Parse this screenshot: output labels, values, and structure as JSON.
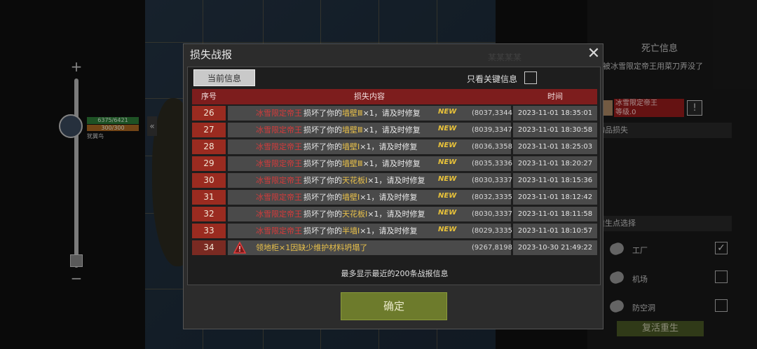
{
  "left_hud": {
    "zoom_in": "+",
    "zoom_out": "−",
    "hp": "6375/6421",
    "energy": "300/300",
    "player_name": "犹翼鸟",
    "collapse_glyph": "«"
  },
  "right_panel": {
    "title": "死亡信息",
    "description": "被冰雪限定帝王用菜刀弄没了",
    "killer_name": "冰雪限定帝王",
    "killer_level": "等级.0",
    "warn_glyph": "!",
    "section_loss": "物品损失",
    "section_respawn": "重生点选择",
    "options": [
      {
        "label": "工厂",
        "checked": "✓"
      },
      {
        "label": "机场",
        "checked": ""
      },
      {
        "label": "防空洞",
        "checked": ""
      }
    ],
    "revive_label": "复活重生"
  },
  "modal": {
    "title": "损失战报",
    "watermark": "某某某某",
    "close_glyph": "✕",
    "tab_current": "当前信息",
    "key_only_label": "只看关键信息",
    "columns": {
      "num": "序号",
      "content": "损失内容",
      "time": "时间"
    },
    "new_tag": "NEW",
    "rows": [
      {
        "num": "26",
        "attacker": "冰雪限定帝王",
        "msg_pre": "损坏了你的",
        "item": "墙壁Ⅲ",
        "msg_post": "×1，请及时修复",
        "coord": "(8037,3344)",
        "time": "2023-11-01 18:35:01"
      },
      {
        "num": "27",
        "attacker": "冰雪限定帝王",
        "msg_pre": "损坏了你的",
        "item": "墙壁Ⅲ",
        "msg_post": "×1，请及时修复",
        "coord": "(8039,3347)",
        "time": "2023-11-01 18:30:58"
      },
      {
        "num": "28",
        "attacker": "冰雪限定帝王",
        "msg_pre": "损坏了你的",
        "item": "墙壁Ⅰ",
        "msg_post": "×1，请及时修复",
        "coord": "(8036,3358)",
        "time": "2023-11-01 18:25:03"
      },
      {
        "num": "29",
        "attacker": "冰雪限定帝王",
        "msg_pre": "损坏了你的",
        "item": "墙壁Ⅲ",
        "msg_post": "×1，请及时修复",
        "coord": "(8035,3336)",
        "time": "2023-11-01 18:20:27"
      },
      {
        "num": "30",
        "attacker": "冰雪限定帝王",
        "msg_pre": "损坏了你的",
        "item": "天花板Ⅰ",
        "msg_post": "×1，请及时修复",
        "coord": "(8030,3337)",
        "time": "2023-11-01 18:15:36"
      },
      {
        "num": "31",
        "attacker": "冰雪限定帝王",
        "msg_pre": "损坏了你的",
        "item": "墙壁Ⅰ",
        "msg_post": "×1，请及时修复",
        "coord": "(8032,3335)",
        "time": "2023-11-01 18:12:42"
      },
      {
        "num": "32",
        "attacker": "冰雪限定帝王",
        "msg_pre": "损坏了你的",
        "item": "天花板Ⅰ",
        "msg_post": "×1，请及时修复",
        "coord": "(8030,3337)",
        "time": "2023-11-01 18:11:58"
      },
      {
        "num": "33",
        "attacker": "冰雪限定帝王",
        "msg_pre": "损坏了你的",
        "item": "半墙Ⅰ",
        "msg_post": "×1，请及时修复",
        "coord": "(8029,3335)",
        "time": "2023-11-01 18:10:57"
      }
    ],
    "last_row": {
      "num": "34",
      "msg": "领地柜×1因缺少维护材料坍塌了",
      "coord": "(9267,8198)",
      "time": "2023-10-30 21:49:22"
    },
    "footer": "最多显示最近的200条战报信息",
    "confirm": "确定"
  },
  "colors": {
    "accent_red": "#9a2b20",
    "header_red": "#7d1d1d",
    "confirm_green": "#6d7b2c",
    "item_yellow": "#e8c04a"
  }
}
